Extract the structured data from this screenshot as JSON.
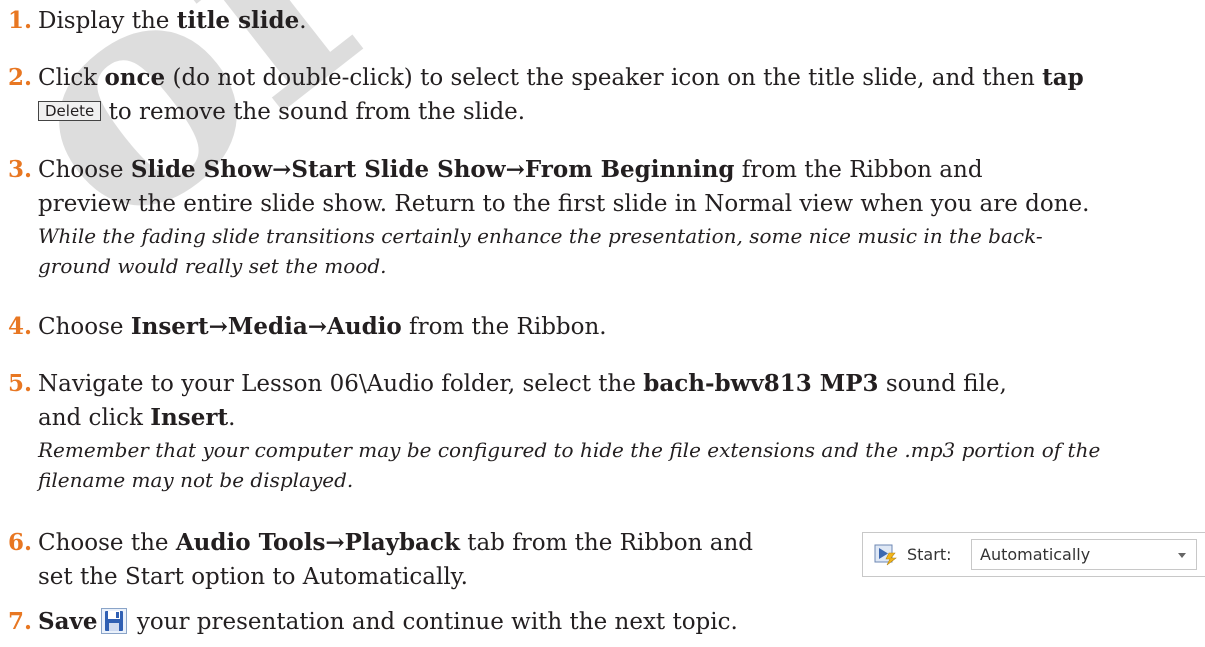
{
  "watermark": "or Evaluation",
  "steps": [
    {
      "num": "1.",
      "t1": "Display the ",
      "b1": "title slide",
      "t2": "."
    },
    {
      "num": "2.",
      "t1": "Click ",
      "b1": "once",
      "t2": " (do not double-click) to select the speaker icon on the title slide, and then ",
      "b2": "tap",
      "key": "Delete",
      "t3": " to remove the sound from the slide."
    },
    {
      "num": "3.",
      "t1": "Choose ",
      "b1": "Slide Show→Start Slide Show→From Beginning",
      "t2": " from the Ribbon and",
      "line2": "preview the entire slide show. Return to the first slide in Normal view when you are done.",
      "note1": "While the fading slide transitions certainly enhance the presentation, some nice music in the back-",
      "note2": "ground would really set the mood."
    },
    {
      "num": "4.",
      "t1": "Choose ",
      "b1": "Insert→Media→Audio",
      "t2": " from the Ribbon."
    },
    {
      "num": "5.",
      "t1": "Navigate to your Lesson 06\\Audio folder, select the ",
      "b1": "bach-bwv813 MP3",
      "t2": " sound file,",
      "line2a": "and click ",
      "line2b": "Insert",
      "line2c": ".",
      "note1": "Remember that your computer may be configured to hide the file extensions and the .mp3 portion of the",
      "note2": "filename may not be displayed."
    },
    {
      "num": "6.",
      "t1": "Choose the ",
      "b1": "Audio Tools→Playback",
      "t2": " tab from the Ribbon and",
      "line2": "set the Start option to Automatically."
    },
    {
      "num": "7.",
      "b1": "Save",
      "t2": " your presentation and continue with the next topic."
    }
  ],
  "start_option": {
    "label": "Start:",
    "value": "Automatically"
  },
  "colors": {
    "step_number": "#e87722",
    "text": "#231f20"
  }
}
